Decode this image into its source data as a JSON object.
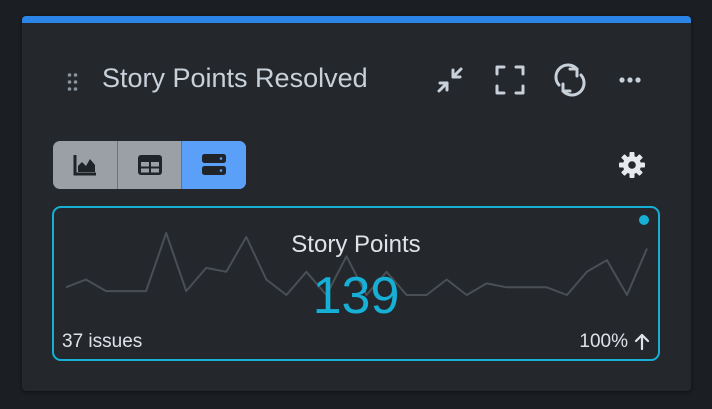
{
  "widget": {
    "title": "Story Points Resolved",
    "accent_color": "#2b85e8",
    "header_actions": [
      {
        "name": "collapse-icon"
      },
      {
        "name": "fullscreen-icon"
      },
      {
        "name": "refresh-icon"
      },
      {
        "name": "more-options-icon"
      }
    ],
    "view_modes": [
      {
        "name": "area-chart-icon",
        "active": false
      },
      {
        "name": "table-icon",
        "active": false
      },
      {
        "name": "list-view-icon",
        "active": true
      }
    ],
    "settings_icon": "gear-icon"
  },
  "metric": {
    "label": "Story Points",
    "value": "139",
    "issues": "37 issues",
    "trend_percent": "100%",
    "trend_direction": "up",
    "highlight_color": "#16b0d6",
    "sparkline": [
      2,
      4,
      1,
      1,
      1,
      16,
      1,
      7,
      6,
      15,
      4,
      0,
      6,
      0,
      10,
      0,
      6,
      0,
      0,
      4,
      0,
      3,
      2,
      2,
      2,
      0,
      6,
      9,
      0,
      12
    ]
  }
}
